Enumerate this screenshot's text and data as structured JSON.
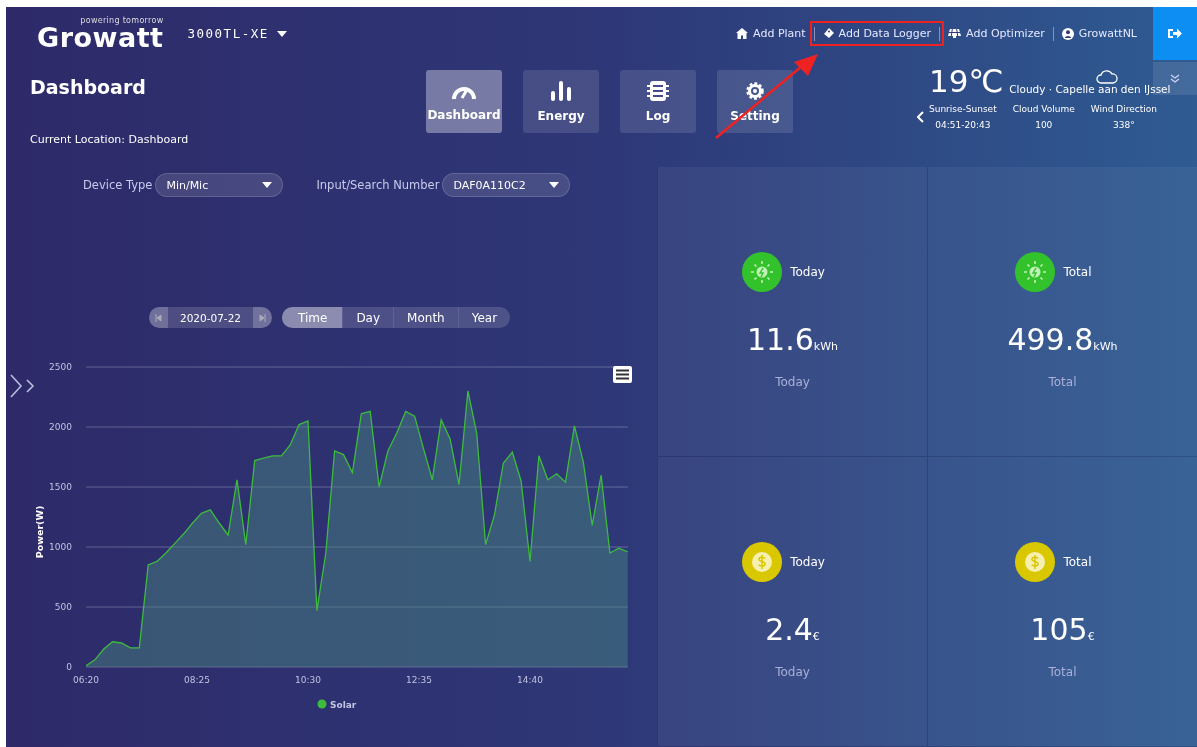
{
  "header": {
    "tagline": "powering tomorrow",
    "logo": "Growatt",
    "plant": "3000TL-XE",
    "links": [
      {
        "label": "Add Plant",
        "kind": "plant"
      },
      {
        "label": "Add Data Logger",
        "kind": "logger"
      },
      {
        "label": "Add Optimizer",
        "kind": "optimizer"
      },
      {
        "label": "GrowattNL",
        "kind": "user"
      }
    ]
  },
  "page": {
    "title": "Dashboard",
    "location": "Current Location: Dashboard"
  },
  "nav": [
    {
      "label": "Dashboard",
      "kind": "gauge",
      "selected": true
    },
    {
      "label": "Energy",
      "kind": "bars",
      "selected": false
    },
    {
      "label": "Log",
      "kind": "log",
      "selected": false
    },
    {
      "label": "Setting",
      "kind": "gear",
      "selected": false
    }
  ],
  "weather": {
    "temperature": "19℃",
    "condition": "Cloudy · Capelle aan den IJssel",
    "items": [
      {
        "label": "Sunrise-Sunset",
        "value": "04:51-20:43"
      },
      {
        "label": "Cloud Volume",
        "value": "100"
      },
      {
        "label": "Wind Direction",
        "value": "338°"
      }
    ]
  },
  "filters": [
    {
      "label": "Device Type",
      "value": "Min/Mic"
    },
    {
      "label": "Input/Search Number",
      "value": "DAF0A110C2"
    }
  ],
  "date": "2020-07-22",
  "periods": [
    {
      "label": "Time",
      "selected": true
    },
    {
      "label": "Day",
      "selected": false
    },
    {
      "label": "Month",
      "selected": false
    },
    {
      "label": "Year",
      "selected": false
    }
  ],
  "chart": {
    "chart_data": {
      "type": "area",
      "ylabel": "Power(W)",
      "x": [
        380,
        390,
        400,
        410,
        420,
        430,
        440,
        450,
        460,
        470,
        480,
        490,
        500,
        510,
        520,
        530,
        540,
        550,
        560,
        570,
        580,
        590,
        600,
        610,
        620,
        630,
        640,
        650,
        660,
        670,
        680,
        690,
        700,
        710,
        720,
        730,
        740,
        750,
        760,
        770,
        780,
        790,
        800,
        810,
        820,
        830,
        840,
        850,
        860,
        870,
        880,
        890,
        900,
        910,
        920,
        930,
        940,
        950,
        960,
        970,
        980,
        990
      ],
      "series": [
        {
          "name": "Solar",
          "color": "#3dbb3d",
          "values": [
            10,
            60,
            150,
            210,
            200,
            160,
            160,
            850,
            880,
            950,
            1030,
            1110,
            1200,
            1280,
            1310,
            1200,
            1100,
            1560,
            1020,
            1720,
            1740,
            1760,
            1760,
            1850,
            2020,
            2050,
            470,
            950,
            1800,
            1770,
            1620,
            2110,
            2130,
            1500,
            1800,
            1950,
            2130,
            2090,
            1820,
            1560,
            2060,
            1900,
            1520,
            2300,
            1950,
            1020,
            1270,
            1700,
            1790,
            1550,
            880,
            1760,
            1560,
            1610,
            1540,
            2010,
            1710,
            1180,
            1600,
            950,
            990,
            960
          ]
        }
      ],
      "xlim": [
        380,
        990
      ],
      "ylim": [
        0,
        2500
      ],
      "xticks": [
        {
          "value": 380,
          "label": "06:20"
        },
        {
          "value": 505,
          "label": "08:25"
        },
        {
          "value": 630,
          "label": "10:30"
        },
        {
          "value": 755,
          "label": "12:35"
        },
        {
          "value": 880,
          "label": "14:40"
        }
      ],
      "yticks": [
        0,
        500,
        1000,
        1500,
        2000,
        2500
      ],
      "grid": true
    }
  },
  "stats": [
    {
      "kind": "energy",
      "label": "Today",
      "value": "11.6",
      "unit": "kWh",
      "caption": "Today"
    },
    {
      "kind": "energy",
      "label": "Total",
      "value": "499.8",
      "unit": "kWh",
      "caption": "Total"
    },
    {
      "kind": "money",
      "label": "Today",
      "value": "2.4",
      "unit": "€",
      "caption": "Today"
    },
    {
      "kind": "money",
      "label": "Total",
      "value": "105",
      "unit": "€",
      "caption": "Total"
    }
  ]
}
